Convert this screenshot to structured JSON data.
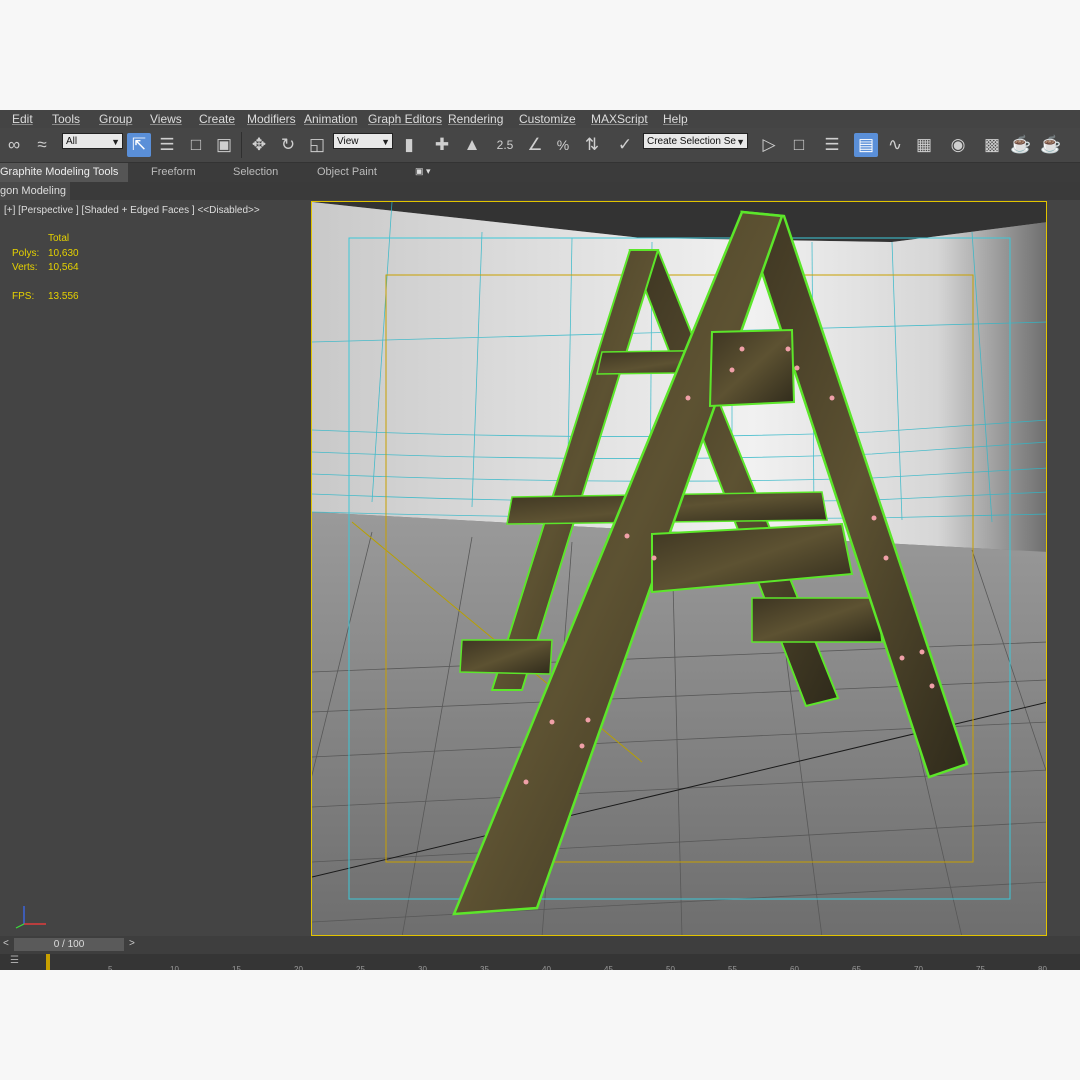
{
  "menu": {
    "items": [
      "Edit",
      "Tools",
      "Group",
      "Views",
      "Create",
      "Modifiers",
      "Animation",
      "Graph Editors",
      "Rendering",
      "Customize",
      "MAXScript",
      "Help"
    ]
  },
  "toolbar": {
    "filter_value": "All",
    "coord_value": "View",
    "snap_label": "2.5",
    "selection_set_placeholder": "Create Selection Se"
  },
  "ribbon": {
    "tabs": [
      "Graphite Modeling Tools",
      "Freeform",
      "Selection",
      "Object Paint"
    ],
    "subtab": "gon Modeling"
  },
  "viewport": {
    "label": "[+] [Perspective ] [Shaded + Edged Faces ]  <<Disabled>>",
    "stats": {
      "header": "Total",
      "polys_label": "Polys:",
      "polys_value": "10,630",
      "verts_label": "Verts:",
      "verts_value": "10,564",
      "fps_label": "FPS:",
      "fps_value": "13.556"
    }
  },
  "timeline": {
    "frame_label": "0 / 100",
    "ticks": [
      "5",
      "10",
      "15",
      "20",
      "25",
      "30",
      "35",
      "40",
      "45",
      "50",
      "55",
      "60",
      "65",
      "70",
      "75",
      "80"
    ]
  },
  "colors": {
    "selection_wire": "#5ce62a",
    "stat_text": "#e6d200",
    "safe_frame": "#3cc8d8",
    "viewport_border": "#e2c400"
  }
}
